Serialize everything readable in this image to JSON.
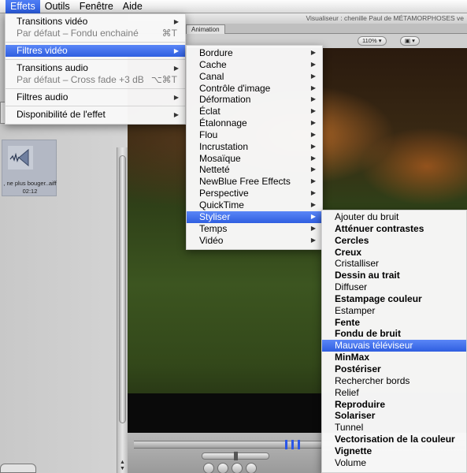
{
  "menubar": {
    "items": [
      "Effets",
      "Outils",
      "Fenêtre",
      "Aide"
    ],
    "active_index": 0
  },
  "effets_menu": {
    "items": [
      {
        "label": "Transitions vidéo",
        "submenu": true
      },
      {
        "label": "Par défaut – Fondu enchainé",
        "shortcut": "⌘T",
        "disabled": true
      },
      {
        "label": "Filtres vidéo",
        "submenu": true,
        "highlighted": true
      },
      {
        "label": "Transitions audio",
        "submenu": true
      },
      {
        "label": "Par défaut – Cross fade +3 dB",
        "shortcut": "⌥⌘T",
        "disabled": true
      },
      {
        "label": "Filtres audio",
        "submenu": true
      },
      {
        "label": "Disponibilité de l'effet",
        "submenu": true
      }
    ]
  },
  "filtres_video_menu": {
    "items": [
      "Bordure",
      "Cache",
      "Canal",
      "Contrôle d'image",
      "Déformation",
      "Éclat",
      "Étalonnage",
      "Flou",
      "Incrustation",
      "Mosaïque",
      "Netteté",
      "NewBlue Free Effects",
      "Perspective",
      "QuickTime",
      "Styliser",
      "Temps",
      "Vidéo"
    ],
    "highlighted": "Styliser"
  },
  "styliser_menu": {
    "items": [
      {
        "label": "Ajouter du bruit",
        "bold": false
      },
      {
        "label": "Atténuer contrastes",
        "bold": true
      },
      {
        "label": "Cercles",
        "bold": true
      },
      {
        "label": "Creux",
        "bold": true
      },
      {
        "label": "Cristalliser",
        "bold": false
      },
      {
        "label": "Dessin au trait",
        "bold": true
      },
      {
        "label": "Diffuser",
        "bold": false
      },
      {
        "label": "Estampage couleur",
        "bold": true
      },
      {
        "label": "Estamper",
        "bold": false
      },
      {
        "label": "Fente",
        "bold": true
      },
      {
        "label": "Fondu de bruit",
        "bold": true
      },
      {
        "label": "Mauvais téléviseur",
        "bold": false,
        "highlighted": true
      },
      {
        "label": "MinMax",
        "bold": true
      },
      {
        "label": "Postériser",
        "bold": true
      },
      {
        "label": "Rechercher bords",
        "bold": false
      },
      {
        "label": "Relief",
        "bold": false
      },
      {
        "label": "Reproduire",
        "bold": true
      },
      {
        "label": "Solariser",
        "bold": true
      },
      {
        "label": "Tunnel",
        "bold": false
      },
      {
        "label": "Vectorisation de la couleur",
        "bold": true
      },
      {
        "label": "Vignette",
        "bold": true
      },
      {
        "label": "Volume",
        "bold": false
      }
    ]
  },
  "viewer": {
    "title": "Visualiseur : chenille Paul de MÉTAMORPHOSES ve",
    "tab_label": "Animation",
    "zoom": "110%"
  },
  "browser": {
    "clip_name": ", ne plus bouger..aiff",
    "clip_duration": "02:12"
  },
  "colors": {
    "highlight": "#3a67e8",
    "menu_bg": "#f8f8f8"
  }
}
